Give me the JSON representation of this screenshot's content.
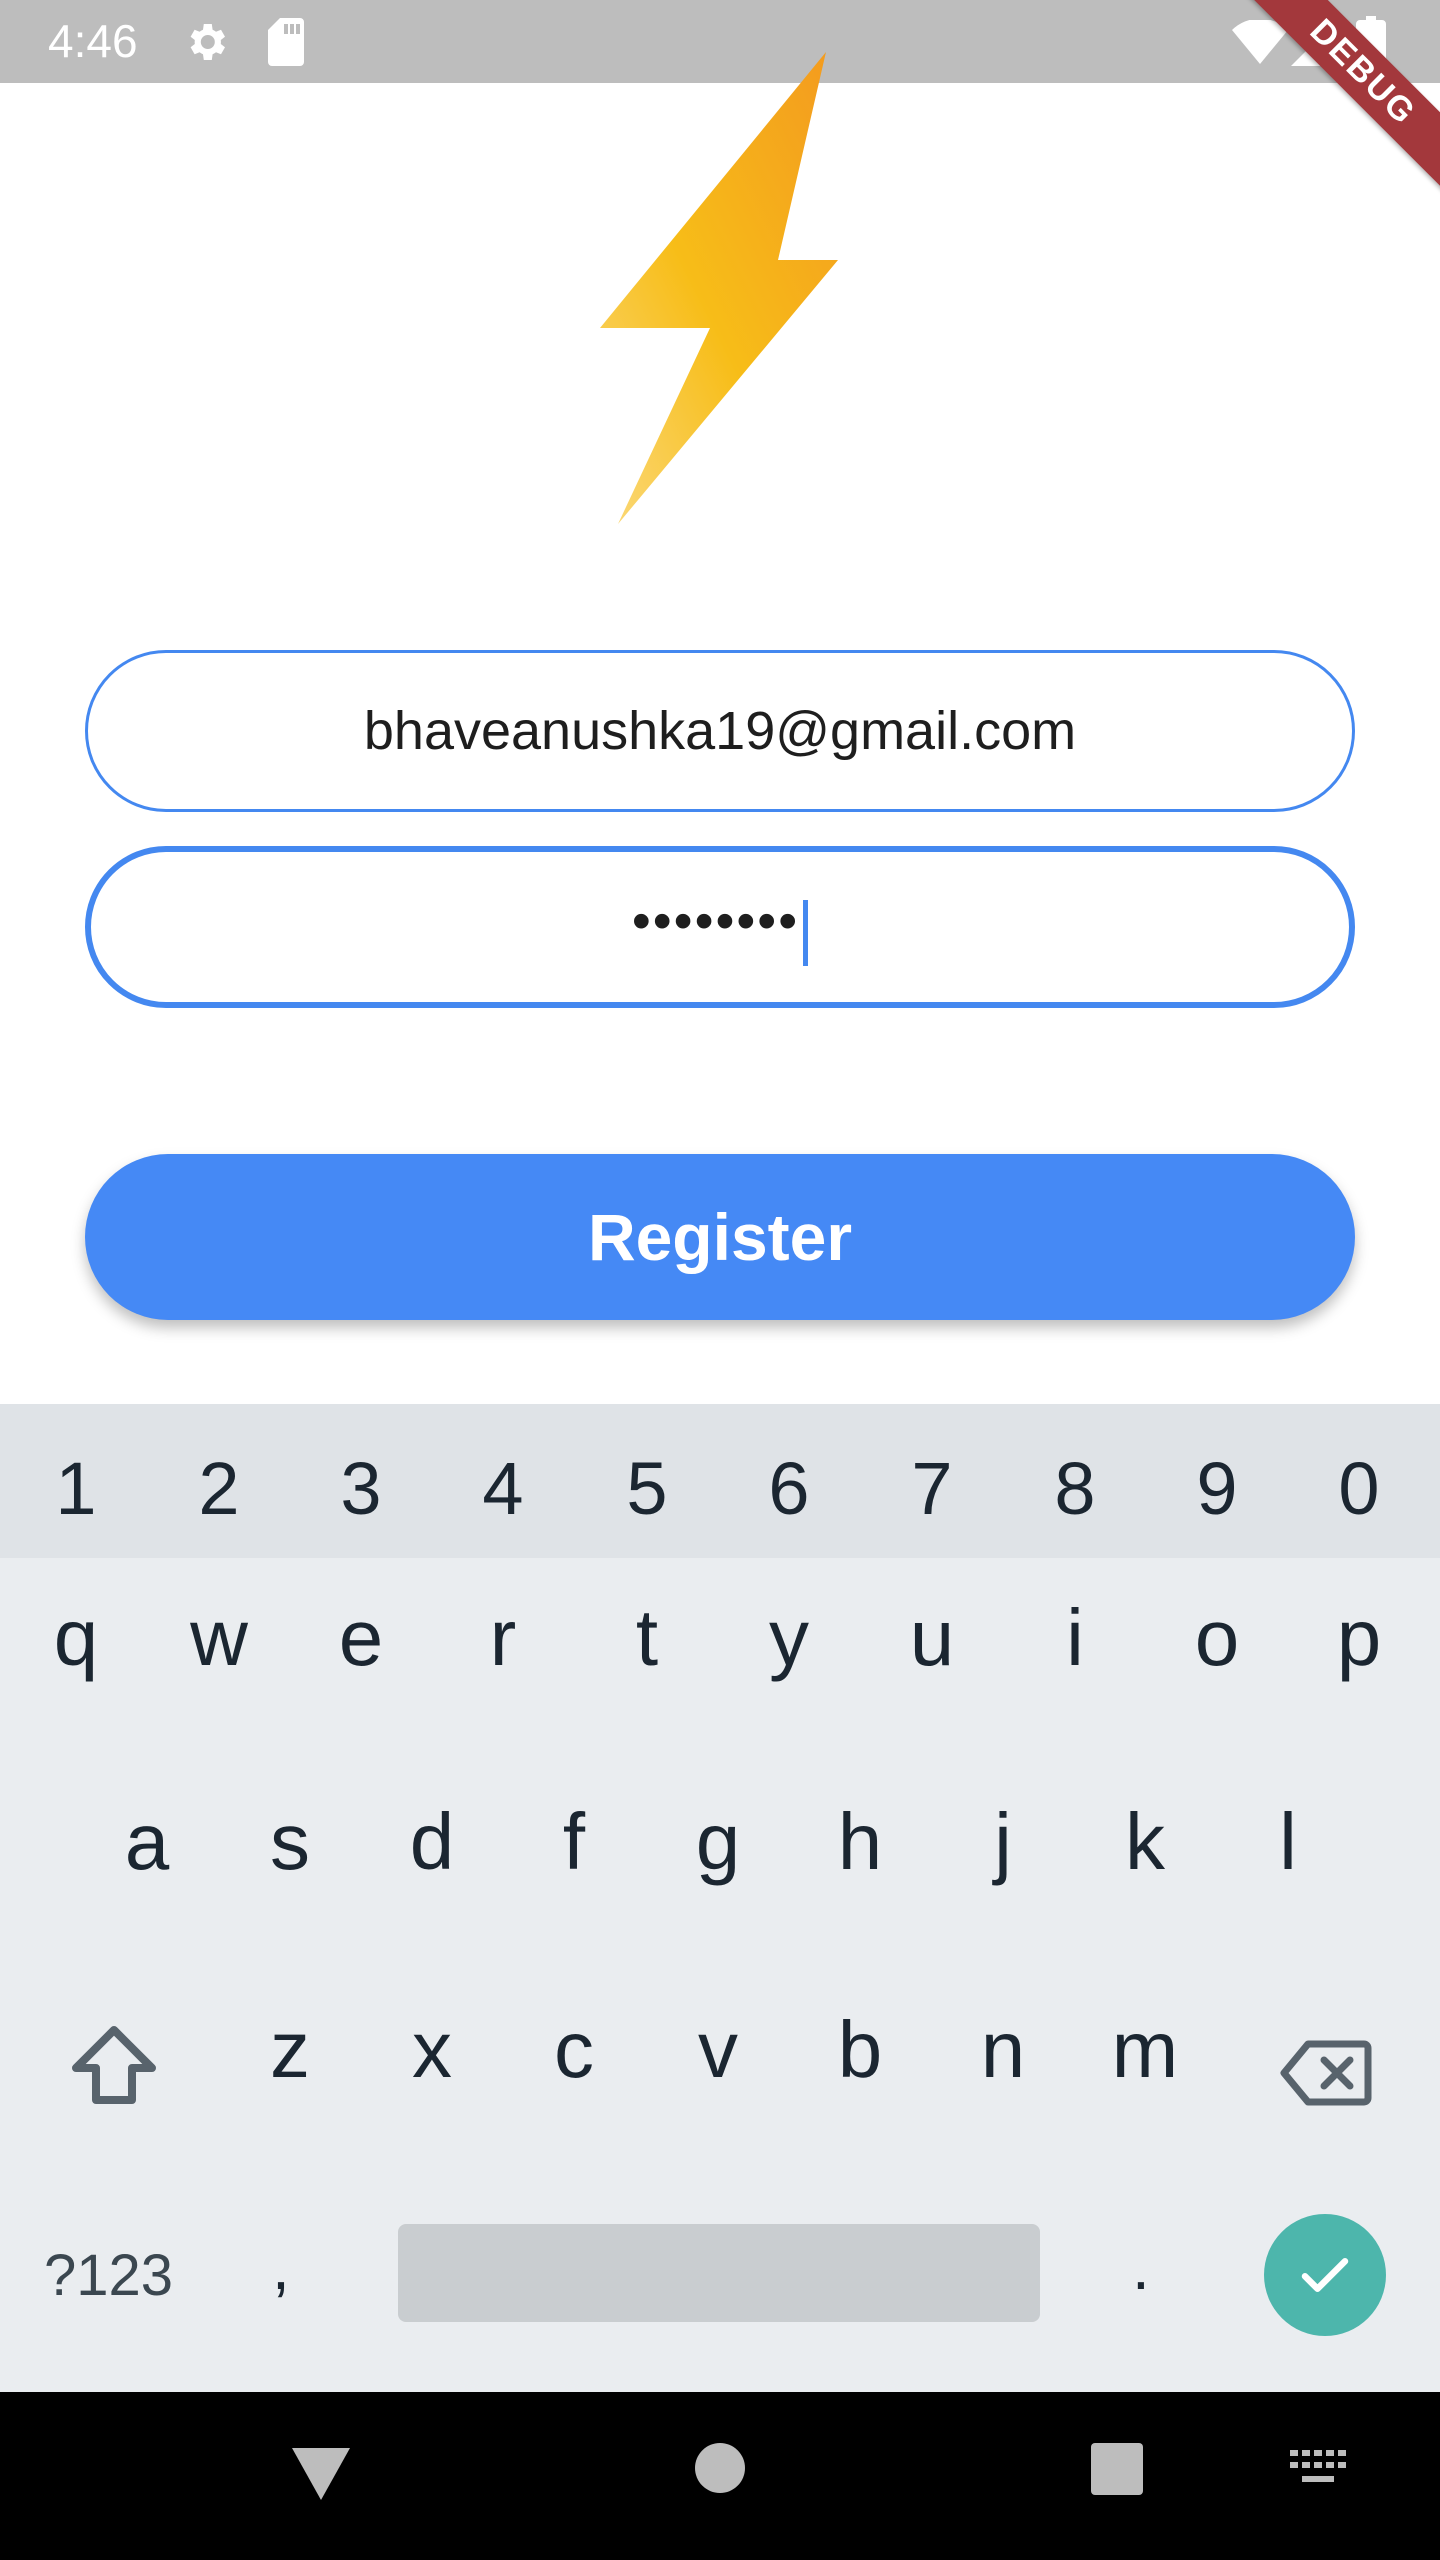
{
  "status_bar": {
    "time": "4:46",
    "icons": [
      "gear-icon",
      "sd-card-icon",
      "wifi-icon",
      "signal-icon",
      "battery-icon"
    ]
  },
  "debug_banner": "DEBUG",
  "logo": {
    "icon": "lightning-bolt-icon",
    "colors": [
      "#f5a623",
      "#f8c01b"
    ]
  },
  "form": {
    "email_value": "bhaveanushka19@gmail.com",
    "password_value": "••••••••",
    "register_label": "Register"
  },
  "keyboard": {
    "numbers": [
      "1",
      "2",
      "3",
      "4",
      "5",
      "6",
      "7",
      "8",
      "9",
      "0"
    ],
    "row1": [
      "q",
      "w",
      "e",
      "r",
      "t",
      "y",
      "u",
      "i",
      "o",
      "p"
    ],
    "row2": [
      "a",
      "s",
      "d",
      "f",
      "g",
      "h",
      "j",
      "k",
      "l"
    ],
    "row3": [
      "z",
      "x",
      "c",
      "v",
      "b",
      "n",
      "m"
    ],
    "symbols_label": "?123",
    "comma": ",",
    "period": "."
  },
  "colors": {
    "accent": "#4589f5",
    "done_button": "#4db6ac",
    "status_bar": "#bdbdbd"
  }
}
